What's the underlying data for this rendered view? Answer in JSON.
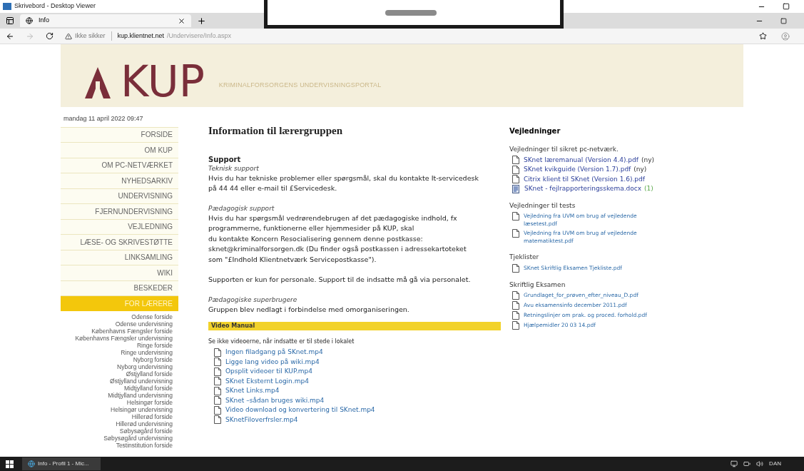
{
  "window": {
    "title": "Skrivebord - Desktop Viewer"
  },
  "tabs": [
    {
      "label": "Info",
      "selected": true
    }
  ],
  "address_bar": {
    "security": "Ikke sikker",
    "host": "kup.klientnet.net",
    "path": "/Undervisere/Info.aspx"
  },
  "logo": {
    "text": "KUP",
    "tagline": "KRIMINALFORSORGENS UNDERVISNINGSPORTAL"
  },
  "sidebar": {
    "date": "mandag 11 april 2022 09:47",
    "items": [
      {
        "label": "FORSIDE",
        "selected": false
      },
      {
        "label": "OM KUP",
        "selected": false
      },
      {
        "label": "OM PC-NETVÆRKET",
        "selected": false
      },
      {
        "label": "NYHEDSARKIV",
        "selected": false
      },
      {
        "label": "UNDERVISNING",
        "selected": false
      },
      {
        "label": "FJERNUNDERVISNING",
        "selected": false
      },
      {
        "label": "VEJLEDNING",
        "selected": false
      },
      {
        "label": "LÆSE- OG SKRIVESTØTTE",
        "selected": false
      },
      {
        "label": "LINKSAMLING",
        "selected": false
      },
      {
        "label": "WIKI",
        "selected": false
      },
      {
        "label": "BESKEDER",
        "selected": false
      },
      {
        "label": "FOR LÆRERE",
        "selected": true
      }
    ],
    "sublinks": [
      "Odense forside",
      "Odense undervisning",
      "Københavns Fængsler forside",
      "Københavns Fængsler undervisning",
      "Ringe forside",
      "Ringe undervisning",
      "Nyborg forside",
      "Nyborg undervisning",
      "Østjylland forside",
      "Østjylland undervisning",
      "Midtjylland forside",
      "Midtjylland undervisning",
      "Helsingør forside",
      "Helsingør undervisning",
      "Hillerød forside",
      "Hillerød undervisning",
      "Søbysøgård forside",
      "Søbysøgård undervisning",
      "Testinstitution forside"
    ]
  },
  "main": {
    "title": "Information til lærergruppen",
    "blocks": [
      {
        "kind": "section",
        "text": "Support"
      },
      {
        "kind": "label",
        "text": "Teknisk support"
      },
      {
        "kind": "text",
        "text": "Hvis du har tekniske problemer eller spørgsmål, skal du kontakte It-servicedesk\npå 44 44 eller e-mail til £Servicedesk."
      },
      {
        "kind": "label",
        "text": "Pædagogisk support"
      },
      {
        "kind": "text",
        "text": "Hvis du har spørgsmål vedrørendebrugen af det pædagogiske indhold, fx\nprogrammerne, funktionerne eller hjemmesider på KUP, skal\ndu kontakte Koncern Resocialisering gennem denne postkasse:\nsknet@kriminalforsorgen.dk (Du finder også postkassen i adressekartoteket\nsom \"£Indhold Klientnetværk Servicepostkasse\")."
      },
      {
        "kind": "note",
        "text": "Supporten er kun for personale. Support til de indsatte må gå via personalet."
      },
      {
        "kind": "label",
        "text": "Pædagogiske superbrugere"
      },
      {
        "kind": "text",
        "text": "Gruppen blev nedlagt i forbindelse med omorganiseringen."
      }
    ],
    "video": {
      "heading": "Video Manual",
      "note": "Se ikke videoerne, når indsatte er til stede i lokalet",
      "files": [
        "Ingen filadgang på SKnet.mp4",
        "Ligge lang video på wiki.mp4",
        "Opsplit videoer til KUP.mp4",
        "SKnet Eksternt Login.mp4",
        "SKnet Links.mp4",
        "SKnet –sådan bruges wiki.mp4",
        "Video download og konvertering til SKnet.mp4",
        "SKnetFiloverfrsler.mp4"
      ]
    }
  },
  "guides": {
    "title": "Vejledninger",
    "groups": [
      {
        "title": "Vejledninger til sikret pc-netværk.",
        "compact": false,
        "items": [
          {
            "kind": "file",
            "text": "SKnet læremanual (Version 4.4).pdf",
            "suffix": "(ny)"
          },
          {
            "kind": "file",
            "text": "SKnet kvikguide (Version 1.7).pdf",
            "suffix": "(ny)"
          },
          {
            "kind": "file",
            "text": "Citrix klient til SKnet (Version 1.6).pdf"
          },
          {
            "kind": "document",
            "text": "SKnet - fejlrapporteringsskema.docx",
            "count": "(1)"
          }
        ]
      },
      {
        "title": "Vejledninger til tests",
        "compact": true,
        "items": [
          {
            "kind": "file",
            "text": "Vejledning fra UVM om brug af vejledende læsetest.pdf"
          },
          {
            "kind": "file",
            "text": "Vejledning fra UVM om brug af vejledende matematiktest.pdf"
          }
        ]
      },
      {
        "title": "Tjeklister",
        "compact": true,
        "items": [
          {
            "kind": "file",
            "text": "SKnet Skriftlig Eksamen Tjekliste.pdf"
          }
        ]
      },
      {
        "title": "Skriftlig Eksamen",
        "compact": true,
        "items": [
          {
            "kind": "file",
            "text": "Grundlaget_for_prøven_efter_niveau_D.pdf"
          },
          {
            "kind": "file",
            "text": "Avu eksamensinfo december 2011.pdf"
          },
          {
            "kind": "file",
            "text": "Retningslinjer om prak. og proced. forhold.pdf"
          },
          {
            "kind": "file",
            "text": "Hjælpemidler 20 03 14.pdf"
          }
        ]
      }
    ]
  },
  "taskbar": {
    "app": "Info - Profil 1 - Mic...",
    "language": "DAN"
  }
}
